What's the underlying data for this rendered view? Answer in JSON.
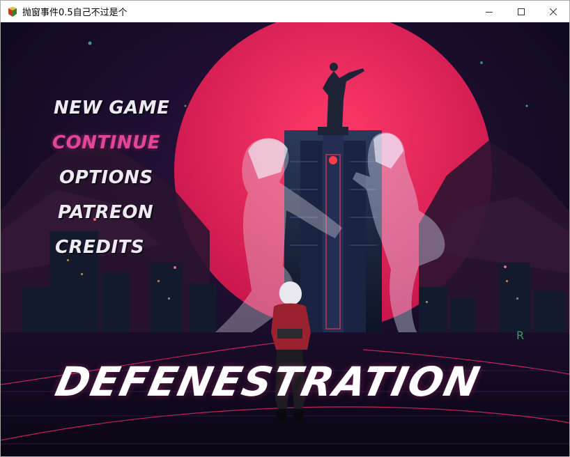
{
  "window": {
    "title": "抛窗事件0.5自己不过是个",
    "controls": {
      "minimize": "minimize-icon",
      "maximize": "maximize-icon",
      "close": "close-icon"
    }
  },
  "game": {
    "menu": [
      {
        "label": "NEW GAME",
        "state": "normal"
      },
      {
        "label": "CONTINUE",
        "state": "hover"
      },
      {
        "label": "OPTIONS",
        "state": "normal"
      },
      {
        "label": "PATREON",
        "state": "normal"
      },
      {
        "label": "CREDITS",
        "state": "normal"
      }
    ],
    "logo_text": "DEFENESTRATION",
    "colors": {
      "sky": "#120a22",
      "sun": "#e8285a",
      "accent": "#e0479a",
      "menu_text": "#eeeaf2",
      "grid": "#ff2a6d"
    }
  }
}
